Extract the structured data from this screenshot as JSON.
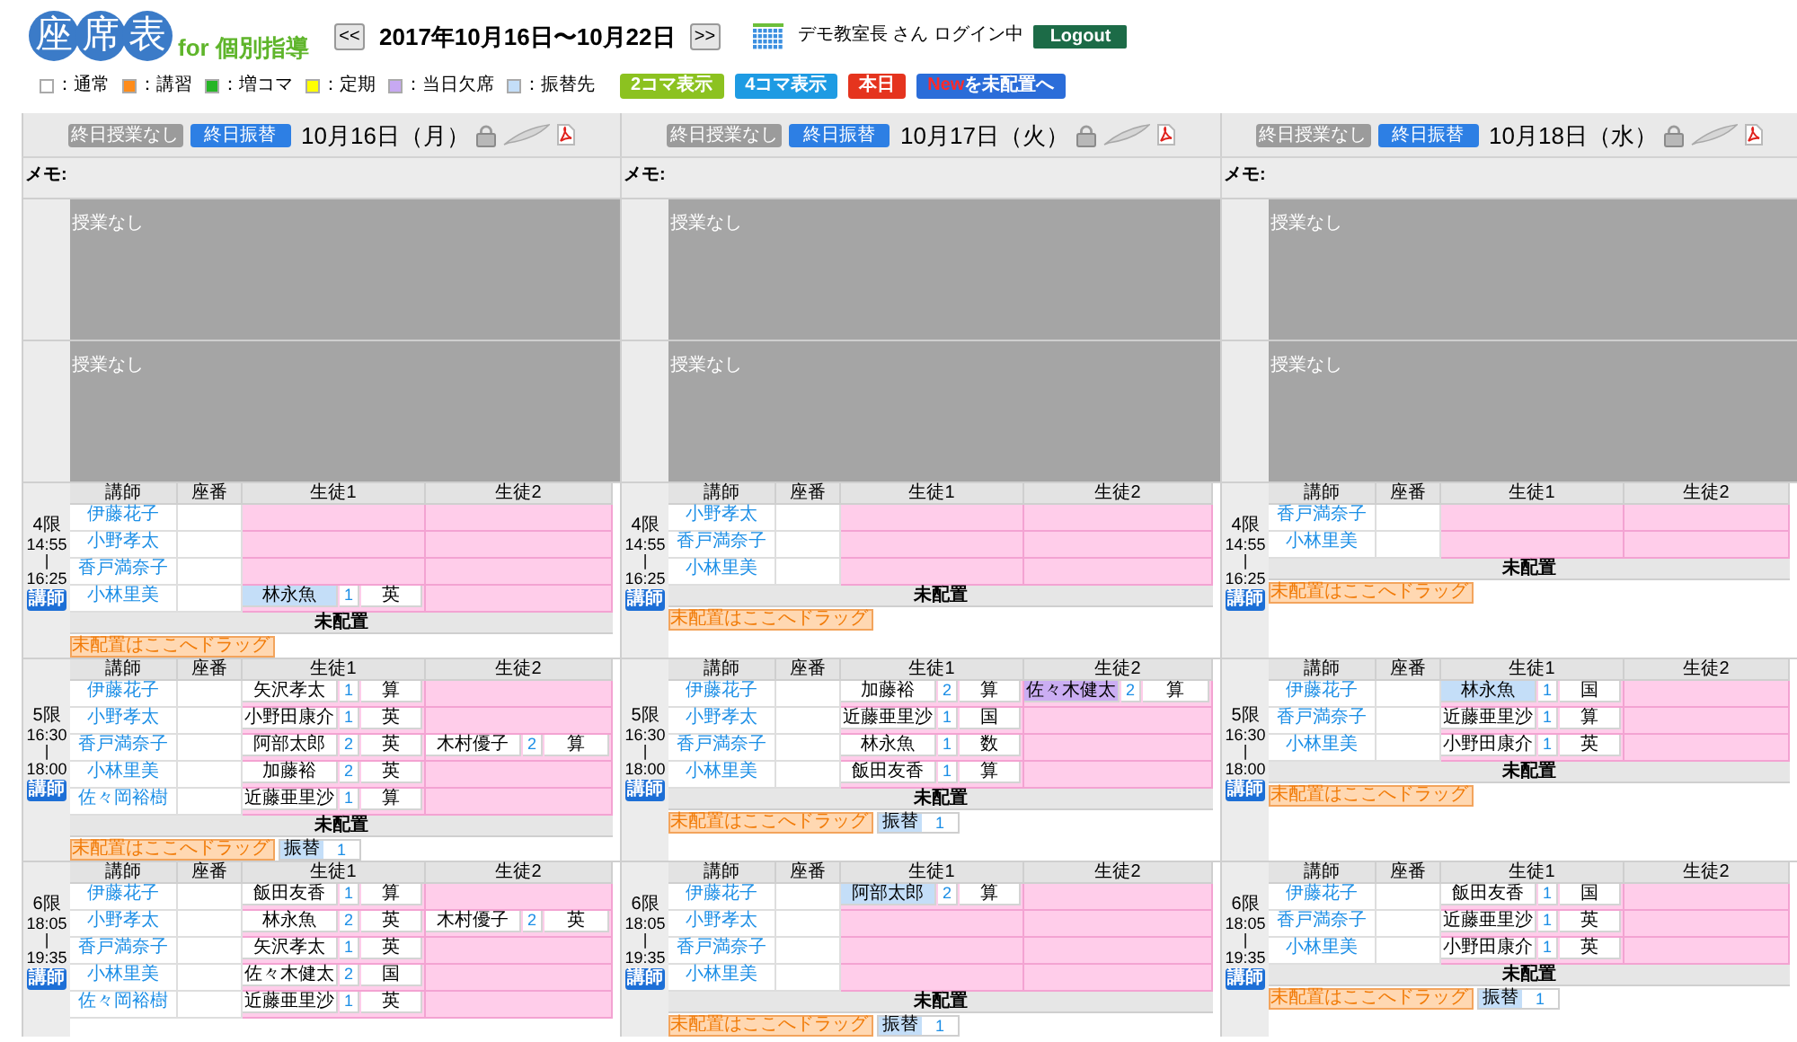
{
  "header": {
    "logo_chars": [
      "座",
      "席",
      "表"
    ],
    "logo_subtitle": "for 個別指導",
    "prev_button": "<<",
    "week_range": "2017年10月16日〜10月22日",
    "next_button": ">>",
    "user_status": "デモ教室長 さん ログイン中",
    "logout_button": "Logout"
  },
  "legend": [
    {
      "label": "：通常",
      "color": "#ffffff"
    },
    {
      "label": "：講習",
      "color": "#ff8c1a"
    },
    {
      "label": "：増コマ",
      "color": "#26b526"
    },
    {
      "label": "：定期",
      "color": "#ffff00"
    },
    {
      "label": "：当日欠席",
      "color": "#c7a9f2"
    },
    {
      "label": "：振替先",
      "color": "#c4def8"
    }
  ],
  "view_buttons": [
    {
      "label": "2コマ表示",
      "color": "#8cc220"
    },
    {
      "label": "4コマ表示",
      "color": "#1e9be3"
    },
    {
      "label": "本日",
      "color": "#e5341e"
    },
    {
      "highlight": "New",
      "label": "を未配置へ",
      "color": "#2b6dd9"
    }
  ],
  "days": [
    {
      "no_class_button": "終日授業なし",
      "transfer_button": "終日振替",
      "date": "10月16日（月）",
      "memo_label": "メモ:",
      "blocks": [
        {
          "label": "授業なし"
        },
        {
          "label": "授業なし"
        }
      ],
      "periods": [
        {
          "name": "4限",
          "start": "14:55",
          "separator": "|",
          "end": "16:25",
          "teacher_button": "講師",
          "columns": [
            "講師",
            "座番",
            "生徒1",
            "生徒2"
          ],
          "rows": [
            {
              "teacher": "伊藤花子"
            },
            {
              "teacher": "小野孝太"
            },
            {
              "teacher": "香戸満奈子"
            },
            {
              "teacher": "小林里美",
              "student_1": {
                "name": "林永魚",
                "count": "1",
                "subject": "英",
                "kind": "transfer"
              }
            }
          ],
          "unplaced": {
            "label": "未配置",
            "drop_hint": "未配置はここへドラッグ"
          }
        },
        {
          "name": "5限",
          "start": "16:30",
          "separator": "|",
          "end": "18:00",
          "teacher_button": "講師",
          "columns": [
            "講師",
            "座番",
            "生徒1",
            "生徒2"
          ],
          "rows": [
            {
              "teacher": "伊藤花子",
              "student_1": {
                "name": "矢沢孝太",
                "count": "1",
                "subject": "算",
                "kind": "regular"
              }
            },
            {
              "teacher": "小野孝太",
              "student_1": {
                "name": "小野田康介",
                "count": "1",
                "subject": "英",
                "kind": "regular"
              }
            },
            {
              "teacher": "香戸満奈子",
              "student_1": {
                "name": "阿部太郎",
                "count": "2",
                "subject": "英",
                "kind": "regular"
              },
              "student_2": {
                "name": "木村優子",
                "count": "2",
                "subject": "算",
                "kind": "regular"
              }
            },
            {
              "teacher": "小林里美",
              "student_1": {
                "name": "加藤裕",
                "count": "2",
                "subject": "英",
                "kind": "regular"
              }
            },
            {
              "teacher": "佐々岡裕樹",
              "student_1": {
                "name": "近藤亜里沙",
                "count": "1",
                "subject": "算",
                "kind": "regular"
              }
            }
          ],
          "unplaced": {
            "label": "未配置",
            "drop_hint": "未配置はここへドラッグ",
            "transfers": [
              {
                "label": "振替",
                "count": "1"
              }
            ]
          }
        },
        {
          "name": "6限",
          "start": "18:05",
          "separator": "|",
          "end": "19:35",
          "teacher_button": "講師",
          "columns": [
            "講師",
            "座番",
            "生徒1",
            "生徒2"
          ],
          "rows": [
            {
              "teacher": "伊藤花子",
              "student_1": {
                "name": "飯田友香",
                "count": "1",
                "subject": "算",
                "kind": "regular"
              }
            },
            {
              "teacher": "小野孝太",
              "student_1": {
                "name": "林永魚",
                "count": "2",
                "subject": "英",
                "kind": "regular"
              },
              "student_2": {
                "name": "木村優子",
                "count": "2",
                "subject": "英",
                "kind": "regular"
              }
            },
            {
              "teacher": "香戸満奈子",
              "student_1": {
                "name": "矢沢孝太",
                "count": "1",
                "subject": "英",
                "kind": "regular"
              }
            },
            {
              "teacher": "小林里美",
              "student_1": {
                "name": "佐々木健太",
                "count": "2",
                "subject": "国",
                "kind": "regular"
              }
            },
            {
              "teacher": "佐々岡裕樹",
              "student_1": {
                "name": "近藤亜里沙",
                "count": "1",
                "subject": "英",
                "kind": "regular"
              }
            }
          ]
        }
      ]
    },
    {
      "no_class_button": "終日授業なし",
      "transfer_button": "終日振替",
      "date": "10月17日（火）",
      "memo_label": "メモ:",
      "blocks": [
        {
          "label": "授業なし"
        },
        {
          "label": "授業なし"
        }
      ],
      "periods": [
        {
          "name": "4限",
          "start": "14:55",
          "separator": "|",
          "end": "16:25",
          "teacher_button": "講師",
          "columns": [
            "講師",
            "座番",
            "生徒1",
            "生徒2"
          ],
          "rows": [
            {
              "teacher": "小野孝太"
            },
            {
              "teacher": "香戸満奈子"
            },
            {
              "teacher": "小林里美"
            }
          ],
          "unplaced": {
            "label": "未配置",
            "drop_hint": "未配置はここへドラッグ"
          }
        },
        {
          "name": "5限",
          "start": "16:30",
          "separator": "|",
          "end": "18:00",
          "teacher_button": "講師",
          "columns": [
            "講師",
            "座番",
            "生徒1",
            "生徒2"
          ],
          "rows": [
            {
              "teacher": "伊藤花子",
              "student_1": {
                "name": "加藤裕",
                "count": "2",
                "subject": "算",
                "kind": "regular"
              },
              "student_2": {
                "name": "佐々木健太",
                "count": "2",
                "subject": "算",
                "kind": "absent"
              }
            },
            {
              "teacher": "小野孝太",
              "student_1": {
                "name": "近藤亜里沙",
                "count": "1",
                "subject": "国",
                "kind": "regular"
              }
            },
            {
              "teacher": "香戸満奈子",
              "student_1": {
                "name": "林永魚",
                "count": "1",
                "subject": "数",
                "kind": "regular"
              }
            },
            {
              "teacher": "小林里美",
              "student_1": {
                "name": "飯田友香",
                "count": "1",
                "subject": "算",
                "kind": "regular"
              }
            }
          ],
          "unplaced": {
            "label": "未配置",
            "drop_hint": "未配置はここへドラッグ",
            "transfers": [
              {
                "label": "振替",
                "count": "1"
              }
            ]
          }
        },
        {
          "name": "6限",
          "start": "18:05",
          "separator": "|",
          "end": "19:35",
          "teacher_button": "講師",
          "columns": [
            "講師",
            "座番",
            "生徒1",
            "生徒2"
          ],
          "rows": [
            {
              "teacher": "伊藤花子",
              "student_1": {
                "name": "阿部太郎",
                "count": "2",
                "subject": "算",
                "kind": "transfer"
              }
            },
            {
              "teacher": "小野孝太"
            },
            {
              "teacher": "香戸満奈子"
            },
            {
              "teacher": "小林里美"
            }
          ],
          "unplaced": {
            "label": "未配置",
            "drop_hint": "未配置はここへドラッグ",
            "transfers": [
              {
                "label": "振替",
                "count": "1"
              }
            ]
          }
        }
      ]
    },
    {
      "no_class_button": "終日授業なし",
      "transfer_button": "終日振替",
      "date": "10月18日（水）",
      "memo_label": "メモ:",
      "blocks": [
        {
          "label": "授業なし"
        },
        {
          "label": "授業なし"
        }
      ],
      "periods": [
        {
          "name": "4限",
          "start": "14:55",
          "separator": "|",
          "end": "16:25",
          "teacher_button": "講師",
          "columns": [
            "講師",
            "座番",
            "生徒1",
            "生徒2"
          ],
          "rows": [
            {
              "teacher": "香戸満奈子"
            },
            {
              "teacher": "小林里美"
            }
          ],
          "unplaced": {
            "label": "未配置",
            "drop_hint": "未配置はここへドラッグ"
          }
        },
        {
          "name": "5限",
          "start": "16:30",
          "separator": "|",
          "end": "18:00",
          "teacher_button": "講師",
          "columns": [
            "講師",
            "座番",
            "生徒1",
            "生徒2"
          ],
          "rows": [
            {
              "teacher": "伊藤花子",
              "student_1": {
                "name": "林永魚",
                "count": "1",
                "subject": "国",
                "kind": "transfer"
              }
            },
            {
              "teacher": "香戸満奈子",
              "student_1": {
                "name": "近藤亜里沙",
                "count": "1",
                "subject": "算",
                "kind": "regular"
              }
            },
            {
              "teacher": "小林里美",
              "student_1": {
                "name": "小野田康介",
                "count": "1",
                "subject": "英",
                "kind": "regular"
              }
            }
          ],
          "unplaced": {
            "label": "未配置",
            "drop_hint": "未配置はここへドラッグ"
          }
        },
        {
          "name": "6限",
          "start": "18:05",
          "separator": "|",
          "end": "19:35",
          "teacher_button": "講師",
          "columns": [
            "講師",
            "座番",
            "生徒1",
            "生徒2"
          ],
          "rows": [
            {
              "teacher": "伊藤花子",
              "student_1": {
                "name": "飯田友香",
                "count": "1",
                "subject": "国",
                "kind": "regular"
              }
            },
            {
              "teacher": "香戸満奈子",
              "student_1": {
                "name": "近藤亜里沙",
                "count": "1",
                "subject": "英",
                "kind": "regular"
              }
            },
            {
              "teacher": "小林里美",
              "student_1": {
                "name": "小野田康介",
                "count": "1",
                "subject": "英",
                "kind": "regular"
              }
            }
          ],
          "unplaced": {
            "label": "未配置",
            "drop_hint": "未配置はここへドラッグ",
            "transfers": [
              {
                "label": "振替",
                "count": "1"
              }
            ]
          }
        }
      ]
    }
  ]
}
